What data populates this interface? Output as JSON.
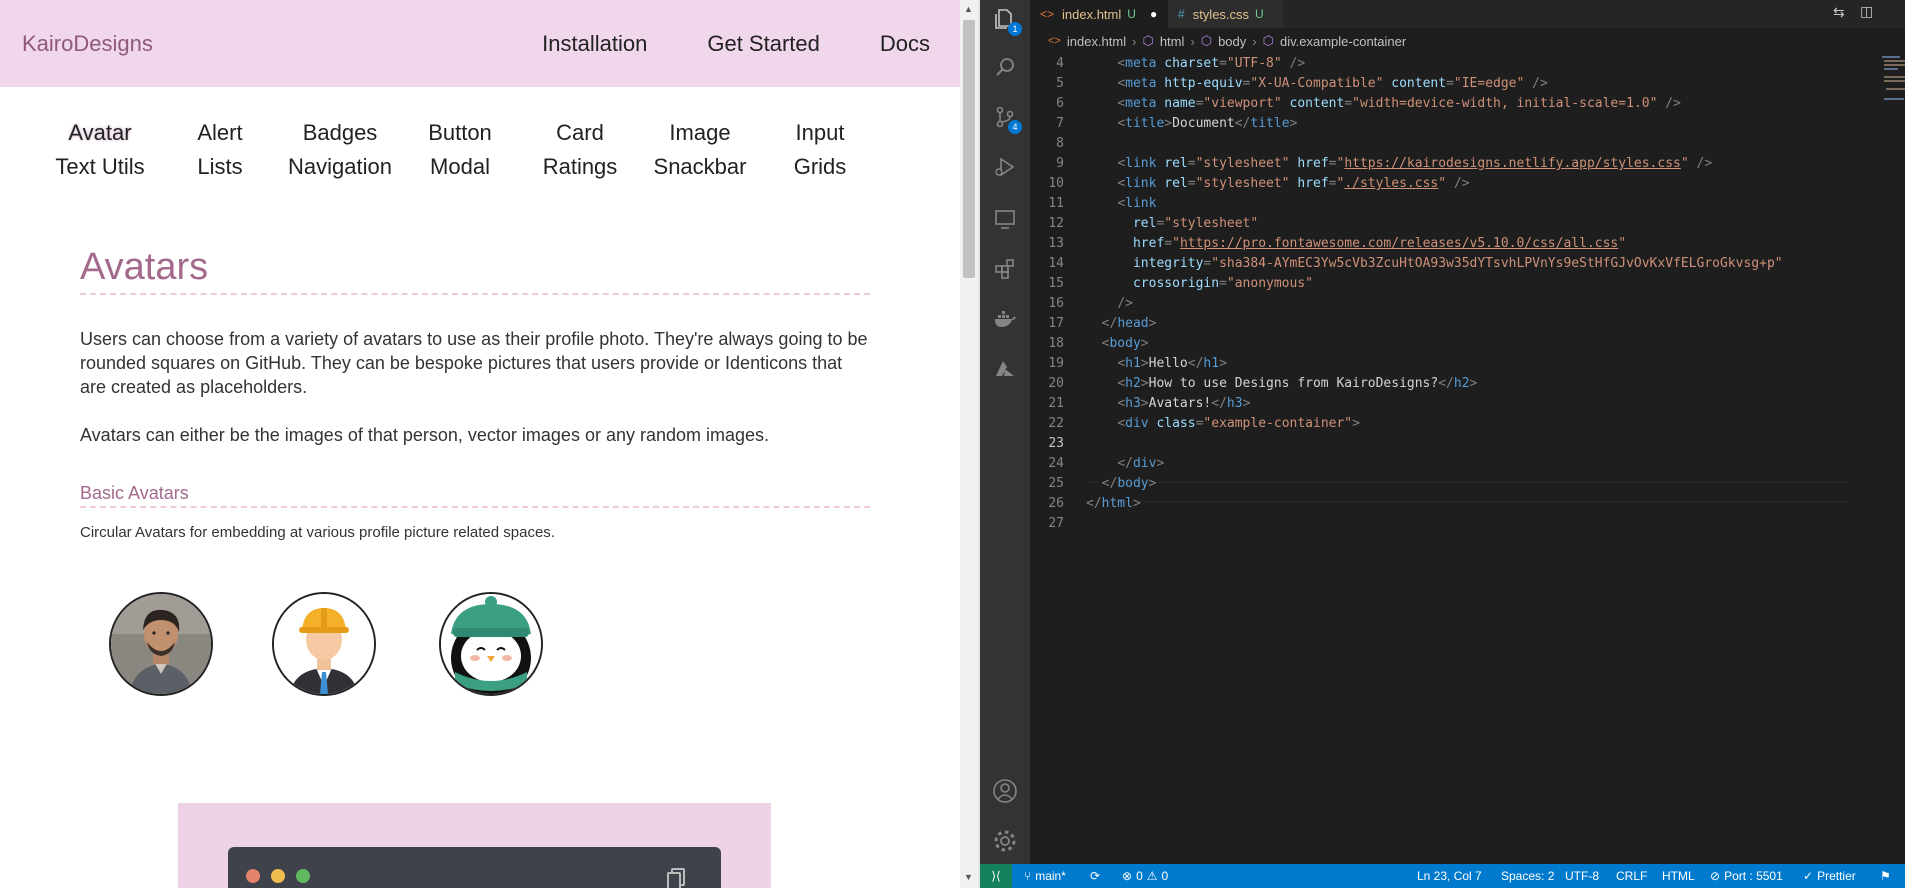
{
  "browser": {
    "brand": "KairoDesigns",
    "top_nav": [
      "Installation",
      "Get Started",
      "Docs"
    ],
    "component_nav": [
      "Avatar",
      "Alert",
      "Badges",
      "Button",
      "Card",
      "Image",
      "Input",
      "Text Utils",
      "Lists",
      "Navigation",
      "Modal",
      "Ratings",
      "Snackbar",
      "Grids"
    ],
    "active_component": "Avatar",
    "heading": "Avatars",
    "paragraph1": "Users can choose from a variety of avatars to use as their profile photo. They're always going to be rounded squares on GitHub. They can be bespoke pictures that users provide or Identicons that are created as placeholders.",
    "paragraph2": "Avatars can either be the images of that person, vector images or any random images.",
    "subheading": "Basic Avatars",
    "subtext": "Circular Avatars for embedding at various profile picture related spaces.",
    "avatars": [
      "man-photo",
      "worker-with-helmet",
      "penguin-with-hat"
    ]
  },
  "vscode": {
    "tabs": [
      {
        "label": "index.html",
        "status": "U",
        "modified": true,
        "active": true
      },
      {
        "label": "styles.css",
        "status": "U",
        "modified": false,
        "active": false
      }
    ],
    "breadcrumbs": [
      "index.html",
      "html",
      "body",
      "div.example-container"
    ],
    "activity_badges": {
      "explorer": "1",
      "source_control": "4"
    },
    "code_lines": [
      {
        "n": "4",
        "indent": "    ",
        "tokens": [
          [
            "t-punc",
            "<"
          ],
          [
            "t-tag",
            "meta"
          ],
          [
            "t-attr",
            " charset"
          ],
          [
            "t-punc",
            "="
          ],
          [
            "t-str",
            "\"UTF-8\""
          ],
          [
            "t-punc",
            " />"
          ]
        ]
      },
      {
        "n": "5",
        "indent": "    ",
        "tokens": [
          [
            "t-punc",
            "<"
          ],
          [
            "t-tag",
            "meta"
          ],
          [
            "t-attr",
            " http-equiv"
          ],
          [
            "t-punc",
            "="
          ],
          [
            "t-str",
            "\"X-UA-Compatible\""
          ],
          [
            "t-attr",
            " content"
          ],
          [
            "t-punc",
            "="
          ],
          [
            "t-str",
            "\"IE=edge\""
          ],
          [
            "t-punc",
            " />"
          ]
        ]
      },
      {
        "n": "6",
        "indent": "    ",
        "tokens": [
          [
            "t-punc",
            "<"
          ],
          [
            "t-tag",
            "meta"
          ],
          [
            "t-attr",
            " name"
          ],
          [
            "t-punc",
            "="
          ],
          [
            "t-str",
            "\"viewport\""
          ],
          [
            "t-attr",
            " content"
          ],
          [
            "t-punc",
            "="
          ],
          [
            "t-str",
            "\"width=device-width, initial-scale=1.0\""
          ],
          [
            "t-punc",
            " />"
          ]
        ]
      },
      {
        "n": "7",
        "indent": "    ",
        "tokens": [
          [
            "t-punc",
            "<"
          ],
          [
            "t-tag",
            "title"
          ],
          [
            "t-punc",
            ">"
          ],
          [
            "t-text",
            "Document"
          ],
          [
            "t-punc",
            "</"
          ],
          [
            "t-tag",
            "title"
          ],
          [
            "t-punc",
            ">"
          ]
        ]
      },
      {
        "n": "8",
        "indent": "",
        "tokens": []
      },
      {
        "n": "9",
        "indent": "    ",
        "tokens": [
          [
            "t-punc",
            "<"
          ],
          [
            "t-tag",
            "link"
          ],
          [
            "t-attr",
            " rel"
          ],
          [
            "t-punc",
            "="
          ],
          [
            "t-str",
            "\"stylesheet\""
          ],
          [
            "t-attr",
            " href"
          ],
          [
            "t-punc",
            "="
          ],
          [
            "t-str",
            "\""
          ],
          [
            "t-link",
            "https://kairodesigns.netlify.app/styles.css"
          ],
          [
            "t-str",
            "\""
          ],
          [
            "t-punc",
            " />"
          ]
        ]
      },
      {
        "n": "10",
        "indent": "    ",
        "tokens": [
          [
            "t-punc",
            "<"
          ],
          [
            "t-tag",
            "link"
          ],
          [
            "t-attr",
            " rel"
          ],
          [
            "t-punc",
            "="
          ],
          [
            "t-str",
            "\"stylesheet\""
          ],
          [
            "t-attr",
            " href"
          ],
          [
            "t-punc",
            "="
          ],
          [
            "t-str",
            "\""
          ],
          [
            "t-link",
            "./styles.css"
          ],
          [
            "t-str",
            "\""
          ],
          [
            "t-punc",
            " />"
          ]
        ]
      },
      {
        "n": "11",
        "indent": "    ",
        "tokens": [
          [
            "t-punc",
            "<"
          ],
          [
            "t-tag",
            "link"
          ]
        ]
      },
      {
        "n": "12",
        "indent": "      ",
        "tokens": [
          [
            "t-attr",
            "rel"
          ],
          [
            "t-punc",
            "="
          ],
          [
            "t-str",
            "\"stylesheet\""
          ]
        ]
      },
      {
        "n": "13",
        "indent": "      ",
        "tokens": [
          [
            "t-attr",
            "href"
          ],
          [
            "t-punc",
            "="
          ],
          [
            "t-str",
            "\""
          ],
          [
            "t-link",
            "https://pro.fontawesome.com/releases/v5.10.0/css/all.css"
          ],
          [
            "t-str",
            "\""
          ]
        ]
      },
      {
        "n": "14",
        "indent": "      ",
        "tokens": [
          [
            "t-attr",
            "integrity"
          ],
          [
            "t-punc",
            "="
          ],
          [
            "t-str",
            "\"sha384-AYmEC3Yw5cVb3ZcuHtOA93w35dYTsvhLPVnYs9eStHfGJvOvKxVfELGroGkvsg+p\""
          ]
        ]
      },
      {
        "n": "15",
        "indent": "      ",
        "tokens": [
          [
            "t-attr",
            "crossorigin"
          ],
          [
            "t-punc",
            "="
          ],
          [
            "t-str",
            "\"anonymous\""
          ]
        ]
      },
      {
        "n": "16",
        "indent": "    ",
        "tokens": [
          [
            "t-punc",
            "/>"
          ]
        ]
      },
      {
        "n": "17",
        "indent": "  ",
        "tokens": [
          [
            "t-punc",
            "</"
          ],
          [
            "t-tag",
            "head"
          ],
          [
            "t-punc",
            ">"
          ]
        ]
      },
      {
        "n": "18",
        "indent": "  ",
        "tokens": [
          [
            "t-punc",
            "<"
          ],
          [
            "t-tag",
            "body"
          ],
          [
            "t-punc",
            ">"
          ]
        ]
      },
      {
        "n": "19",
        "indent": "    ",
        "tokens": [
          [
            "t-punc",
            "<"
          ],
          [
            "t-tag",
            "h1"
          ],
          [
            "t-punc",
            ">"
          ],
          [
            "t-text",
            "Hello"
          ],
          [
            "t-punc",
            "</"
          ],
          [
            "t-tag",
            "h1"
          ],
          [
            "t-punc",
            ">"
          ]
        ]
      },
      {
        "n": "20",
        "indent": "    ",
        "tokens": [
          [
            "t-punc",
            "<"
          ],
          [
            "t-tag",
            "h2"
          ],
          [
            "t-punc",
            ">"
          ],
          [
            "t-text",
            "How to use Designs from KairoDesigns?"
          ],
          [
            "t-punc",
            "</"
          ],
          [
            "t-tag",
            "h2"
          ],
          [
            "t-punc",
            ">"
          ]
        ]
      },
      {
        "n": "21",
        "indent": "    ",
        "tokens": [
          [
            "t-punc",
            "<"
          ],
          [
            "t-tag",
            "h3"
          ],
          [
            "t-punc",
            ">"
          ],
          [
            "t-text",
            "Avatars!"
          ],
          [
            "t-punc",
            "</"
          ],
          [
            "t-tag",
            "h3"
          ],
          [
            "t-punc",
            ">"
          ]
        ]
      },
      {
        "n": "22",
        "indent": "    ",
        "tokens": [
          [
            "t-punc",
            "<"
          ],
          [
            "t-tag",
            "div"
          ],
          [
            "t-attr",
            " class"
          ],
          [
            "t-punc",
            "="
          ],
          [
            "t-str",
            "\"example-container\""
          ],
          [
            "t-punc",
            ">"
          ]
        ]
      },
      {
        "n": "23",
        "indent": "",
        "tokens": []
      },
      {
        "n": "24",
        "indent": "    ",
        "tokens": [
          [
            "t-punc",
            "</"
          ],
          [
            "t-tag",
            "div"
          ],
          [
            "t-punc",
            ">"
          ]
        ]
      },
      {
        "n": "25",
        "indent": "  ",
        "tokens": [
          [
            "t-punc",
            "</"
          ],
          [
            "t-tag",
            "body"
          ],
          [
            "t-punc",
            ">"
          ]
        ]
      },
      {
        "n": "26",
        "indent": "",
        "tokens": [
          [
            "t-punc",
            "</"
          ],
          [
            "t-tag",
            "html"
          ],
          [
            "t-punc",
            ">"
          ]
        ]
      },
      {
        "n": "27",
        "indent": "",
        "tokens": []
      }
    ],
    "current_line": "23",
    "status": {
      "branch": "main*",
      "errors": "0",
      "warnings": "0",
      "position": "Ln 23, Col 7",
      "spaces": "Spaces: 2",
      "encoding": "UTF-8",
      "eol": "CRLF",
      "language": "HTML",
      "port": "Port : 5501",
      "formatter": "Prettier"
    },
    "colors": {
      "statusbar": "#007acc",
      "remote": "#16825d",
      "tab_label": "#e2c08d",
      "untracked": "#73c991"
    }
  }
}
